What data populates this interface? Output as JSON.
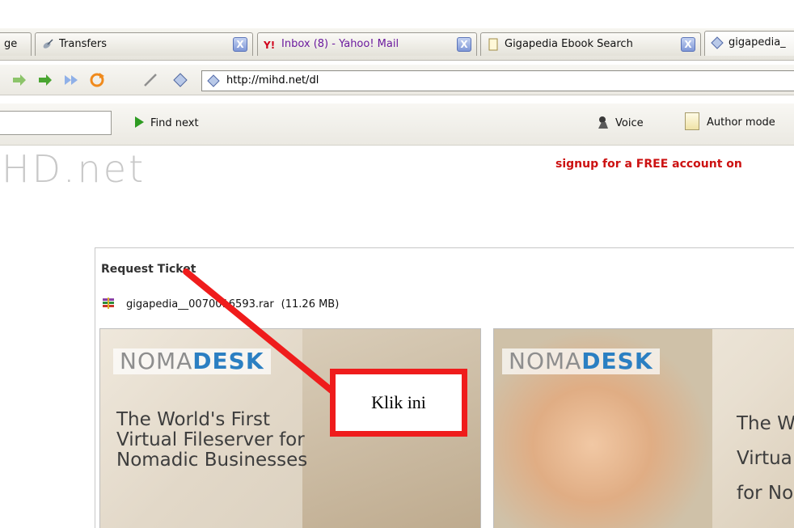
{
  "tabs": [
    {
      "label": "ge",
      "icon": "page-icon",
      "active": false,
      "closable": false
    },
    {
      "label": "Transfers",
      "icon": "satellite-icon",
      "active": false,
      "closable": true
    },
    {
      "label": "Inbox (8) - Yahoo! Mail",
      "icon": "yahoo-icon",
      "active": false,
      "closable": true
    },
    {
      "label": "Gigapedia Ebook Search",
      "icon": "page-icon",
      "active": false,
      "closable": true
    },
    {
      "label": "gigapedia_",
      "icon": "site-icon",
      "active": true,
      "closable": false
    }
  ],
  "tab_close_label": "X",
  "address_bar": {
    "url": "http://mihd.net/dl"
  },
  "find_bar": {
    "input_value": "",
    "find_next_label": "Find next",
    "voice_label": "Voice",
    "author_mode_label": "Author mode"
  },
  "site": {
    "logo_text": "HD.net",
    "signup_text": "signup for a FREE account on"
  },
  "request_panel": {
    "title": "Request Ticket",
    "file_name": "gigapedia__0070016593.rar",
    "file_size": "(11.26 MB)"
  },
  "ads": [
    {
      "brand_light": "NOMA",
      "brand_bold": "DESK",
      "tagline": "The World's First Virtual Fileserver for Nomadic Businesses"
    },
    {
      "brand_light": "NOMA",
      "brand_bold": "DESK",
      "tagline": "The W\nVirtua\nfor No"
    }
  ],
  "annotation": {
    "label": "Klik ini",
    "color": "#ef1c1c"
  },
  "colors": {
    "signup": "#cc1111",
    "brand_accent": "#2b7fc2",
    "tab_close": "#7f97d6"
  }
}
